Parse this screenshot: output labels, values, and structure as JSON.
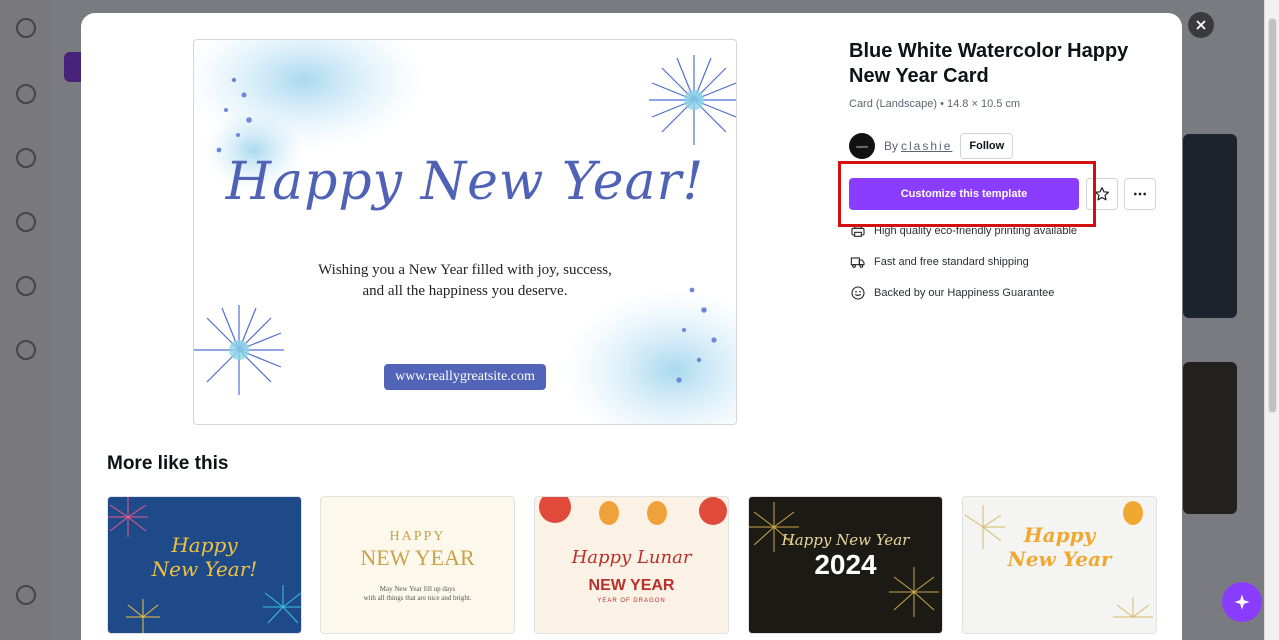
{
  "template": {
    "title": "Blue White Watercolor Happy New Year Card",
    "subtitle": "Card (Landscape) • 14.8 × 10.5 cm",
    "author_prefix": "By",
    "author_name": "clashie",
    "avatar_text": "clashie",
    "follow_label": "Follow",
    "cta_label": "Customize this template",
    "star_icon": "star-icon",
    "more_icon": "more-horizontal-icon"
  },
  "preview": {
    "headline": "Happy New Year!",
    "message_line1": "Wishing you a New Year filled with joy, success,",
    "message_line2": "and all the happiness you deserve.",
    "website": "www.reallygreatsite.com"
  },
  "features": [
    {
      "icon": "printer-icon",
      "text": "High quality eco-friendly printing available"
    },
    {
      "icon": "truck-icon",
      "text": "Fast and free standard shipping"
    },
    {
      "icon": "smile-icon",
      "text": "Backed by our Happiness Guarantee"
    }
  ],
  "more_like_this": {
    "heading": "More like this",
    "items": [
      {
        "line1": "Happy",
        "line2": "New Year!",
        "bg": "#1f4a8a",
        "fg": "#f0c23c"
      },
      {
        "line1": "HAPPY",
        "line2": "NEW YEAR",
        "line3": "May New Year fill up days",
        "line4": "with all things that are nice and bright.",
        "bg": "#fdf8ec",
        "fg": "#c9a24a"
      },
      {
        "line1": "Happy Lunar",
        "line2": "NEW YEAR",
        "line3": "YEAR OF DRAGON",
        "bg": "#fbf1e4",
        "fg": "#b8302a"
      },
      {
        "line1": "Happy New Year",
        "line2": "2024",
        "bg": "#1c1a14",
        "fg": "#e9d79a"
      },
      {
        "line1": "Happy",
        "line2": "New Year",
        "bg": "#f4f4f2",
        "fg": "#f0a830"
      }
    ]
  },
  "colors": {
    "accent": "#8b3dff",
    "highlight": "#d40f0f",
    "card_blue": "#4f62b5"
  }
}
